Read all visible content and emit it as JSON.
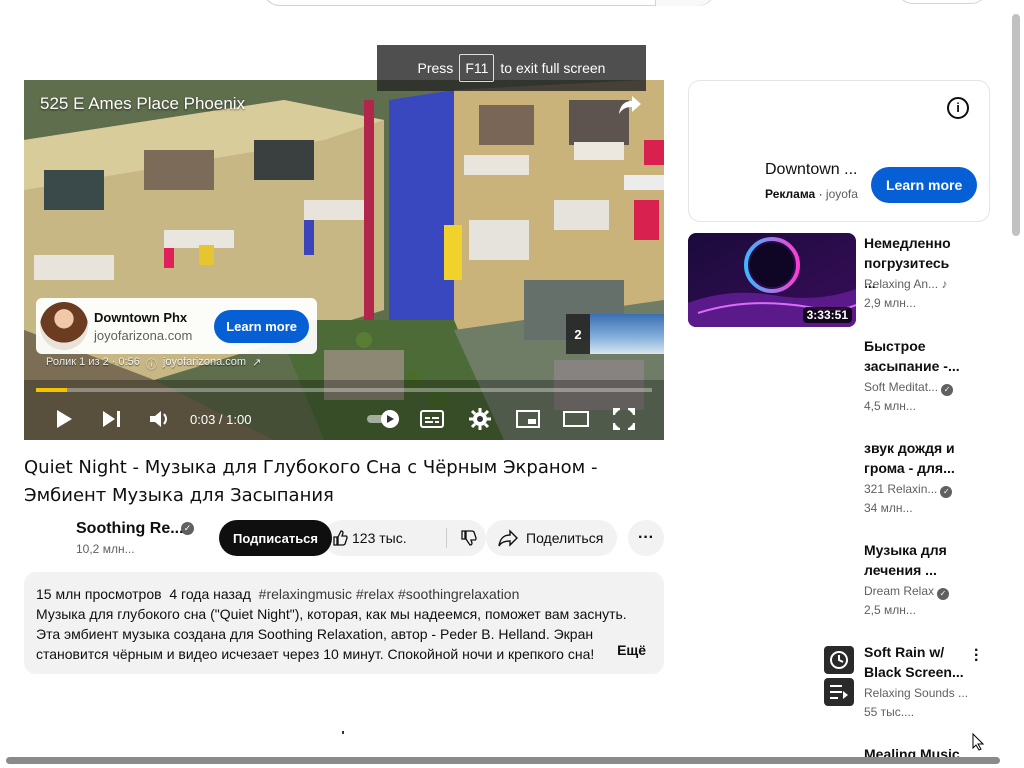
{
  "fullscreen_hint": {
    "press": "Press",
    "key": "F11",
    "rest": "to exit full screen"
  },
  "player": {
    "overlay_title": "525 E Ames Place Phoenix",
    "ad_card": {
      "name": "Downtown Phx",
      "url": "joyofarizona.com",
      "cta": "Learn more"
    },
    "ad_meta": {
      "counter": "Ролик 1 из 2 · 0:56",
      "domain": "joyofarizona.com"
    },
    "side_thumb_count": "2",
    "time": "0:03 / 1:00",
    "progress": 0.05
  },
  "video": {
    "title": "Quiet Night - Музыка для Глубокого Сна с Чёрным Экраном - Эмбиент Музыка для Засыпания",
    "channel": "Soothing Re...",
    "subscribers": "10,2 млн...",
    "subscribe_label": "Подписаться",
    "likes": "123 тыс.",
    "share_label": "Поделиться"
  },
  "description": {
    "views": "15 млн просмотров",
    "age": "4 года назад",
    "tags": "#relaxingmusic #relax #soothingrelaxation",
    "line1": "Музыка для глубокого сна (\"Quiet Night\"), которая, как мы надеемся, поможет вам заснуть.",
    "line2": "Эта эмбиент музыка создана для Soothing Relaxation, автор - Peder B. Helland. Экран",
    "line3": "становится чёрным и видео исчезает через 10 минут. Спокойной ночи и крепкого сна!",
    "more_label": "Ещё"
  },
  "side_ad": {
    "title": "Downtown ...",
    "label": "Реклама",
    "domain": "joyofa",
    "cta": "Learn more"
  },
  "recommendations": [
    {
      "title": "Немедленно погрузитесь ...",
      "channel": "Relaxing An...",
      "views": "2,9 млн...",
      "duration": "3:33:51"
    },
    {
      "title": "Быстрое засыпание -...",
      "channel": "Soft Meditat...",
      "views": "4,5 млн..."
    },
    {
      "title": "звук дождя и грома - для...",
      "channel": "321 Relaxin...",
      "views": "34 млн..."
    },
    {
      "title": "Музыка для лечения ...",
      "channel": "Dream Relax",
      "views": "2,5 млн..."
    },
    {
      "title": "Soft Rain w/ Black Screen...",
      "channel": "Relaxing Sounds ...",
      "views": "55 тыс...."
    },
    {
      "title": "Mealing Music"
    }
  ],
  "colors": {
    "accent_blue": "#065fd4",
    "progress_yellow": "#f4c400",
    "chip_bg": "#f2f2f2"
  }
}
